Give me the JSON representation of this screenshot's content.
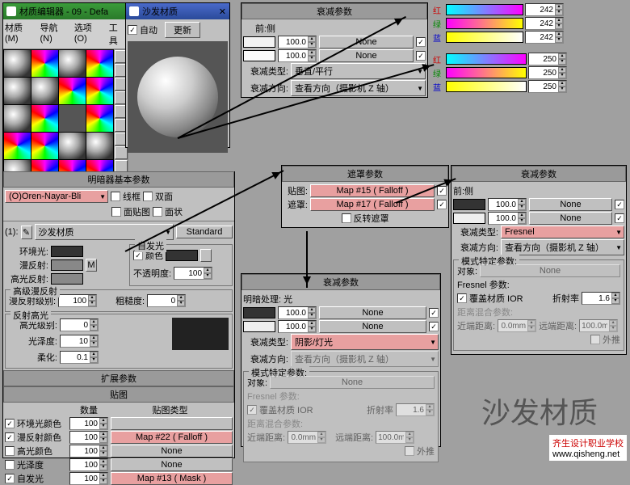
{
  "editor": {
    "title": "材质编辑器 - 09 - Defa",
    "menu": [
      "材质(M)",
      "导航(N)",
      "选项(O)",
      "工具"
    ],
    "shader_section": "明暗器基本参数",
    "shader_dropdown": "(O)Oren-Nayar-Bli",
    "wireframe": "线框",
    "two_sided": "双面",
    "face_map": "面贴图",
    "faceted": "面状",
    "number_label": "(1):",
    "mat_name": "沙发材质",
    "mat_type": "Standard",
    "ambient": "环境光:",
    "diffuse": "漫反射:",
    "specular": "高光反射:",
    "self_illum": "自发光",
    "color_chk": "颜色",
    "opacity": "不透明度:",
    "opacity_val": "100",
    "adv_diffuse": "高级漫反射",
    "diffuse_level": "漫反射级别:",
    "diffuse_level_val": "100",
    "roughness": "粗糙度:",
    "roughness_val": "0",
    "spec_hl": "反射高光",
    "spec_level": "高光级别:",
    "spec_level_val": "0",
    "glossiness": "光泽度:",
    "gloss_val": "10",
    "soften": "柔化:",
    "soften_val": "0.1",
    "ext_section": "扩展参数",
    "maps_section": "贴图",
    "amount": "数量",
    "map_type": "贴图类型",
    "map_rows": [
      {
        "chk": true,
        "label": "环境光颜色",
        "val": "100",
        "map": "",
        "pink": false
      },
      {
        "chk": true,
        "label": "漫反射颜色",
        "val": "100",
        "map": "Map #22 ( Falloff )",
        "pink": true
      },
      {
        "chk": false,
        "label": "高光颜色",
        "val": "100",
        "map": "None",
        "pink": false
      },
      {
        "chk": false,
        "label": "光泽度",
        "val": "100",
        "map": "None",
        "pink": false
      },
      {
        "chk": true,
        "label": "自发光",
        "val": "100",
        "map": "Map #13 ( Mask )",
        "pink": true
      }
    ]
  },
  "popup": {
    "title": "沙发材质",
    "auto": "自动",
    "update": "更新"
  },
  "falloff_top": {
    "section": "衰减参数",
    "front_side": "前:侧",
    "val1": "100.0",
    "map1": "None",
    "val2": "100.0",
    "map2": "None",
    "type_lbl": "衰减类型:",
    "type": "垂直/平行",
    "dir_lbl": "衰减方向:",
    "dir": "查看方向（摄影机 Z 轴）"
  },
  "rgb1": {
    "r": "242",
    "g": "242",
    "b": "242"
  },
  "rgb2": {
    "r": "250",
    "g": "250",
    "b": "250"
  },
  "rgb_labels": {
    "r": "红",
    "g": "绿",
    "b": "蓝"
  },
  "mask": {
    "section": "遮罩参数",
    "map_lbl": "贴图:",
    "mask_lbl": "遮罩:",
    "map": "Map #15 ( Falloff )",
    "mask": "Map #17 ( Falloff )",
    "invert": "反转遮罩"
  },
  "falloff_mid": {
    "section": "衰减参数",
    "darklight": "明暗处理: 光",
    "val1": "100.0",
    "map1": "None",
    "val2": "100.0",
    "map2": "None",
    "type_lbl": "衰减类型:",
    "type": "阴影/灯光",
    "dir_lbl": "衰减方向:",
    "dir": "查看方向（摄影机 Z 轴）",
    "mode": "模式特定参数:",
    "object": "对象:",
    "none": "None",
    "fresnel": "Fresnel 参数:",
    "override": "覆盖材质 IOR",
    "ior_lbl": "折射率",
    "ior": "1.6",
    "dist": "距离混合参数:",
    "near": "近端距离:",
    "near_val": "0.0mm",
    "far": "远端距离:",
    "far_val": "100.0mm",
    "extrap": "外推"
  },
  "falloff_right": {
    "section": "衰减参数",
    "front_side": "前:侧",
    "val1": "100.0",
    "map1": "None",
    "val2": "100.0",
    "map2": "None",
    "type_lbl": "衰减类型:",
    "type": "Fresnel",
    "dir_lbl": "衰减方向:",
    "dir": "查看方向（摄影机 Z 轴）",
    "mode": "模式特定参数:",
    "object": "对象:",
    "none": "None",
    "fresnel": "Fresnel 参数:",
    "override": "覆盖材质 IOR",
    "ior_lbl": "折射率",
    "ior": "1.6",
    "dist": "距离混合参数:",
    "near": "近端距离:",
    "near_val": "0.0mm",
    "far": "远端距离:",
    "far_val": "100.0mm",
    "extrap": "外推"
  },
  "watermark": "沙发材质",
  "credit": {
    "line1": "齐生设计职业学校",
    "line2": "www.qisheng.net"
  }
}
